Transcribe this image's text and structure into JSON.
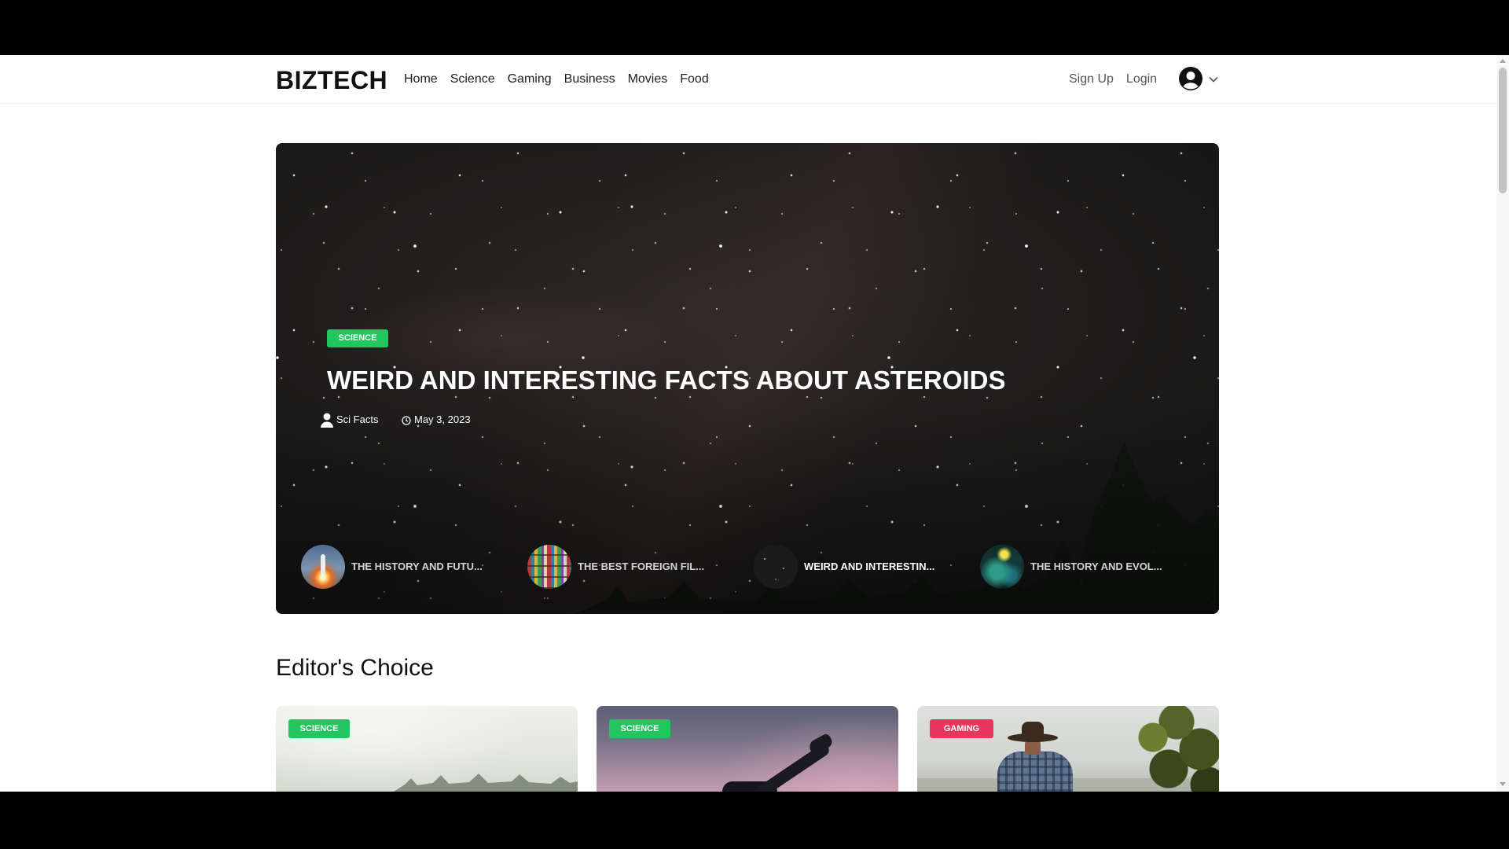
{
  "header": {
    "logo": "BIZTECH",
    "nav": [
      {
        "label": "Home"
      },
      {
        "label": "Science"
      },
      {
        "label": "Gaming"
      },
      {
        "label": "Business"
      },
      {
        "label": "Movies"
      },
      {
        "label": "Food"
      }
    ],
    "auth": {
      "signup": "Sign Up",
      "login": "Login"
    },
    "icons": {
      "avatar": "user-avatar-icon",
      "dropdown": "chevron-down-icon"
    }
  },
  "hero": {
    "category": "SCIENCE",
    "category_color": "#22c55e",
    "title": "WEIRD AND INTERESTING FACTS ABOUT ASTEROIDS",
    "author": "Sci Facts",
    "date": "May 3, 2023",
    "icons": {
      "author": "user-icon",
      "date": "clock-icon"
    },
    "slides": [
      {
        "title": "THE HISTORY AND FUTU...",
        "active": false
      },
      {
        "title": "THE BEST FOREIGN FIL...",
        "active": false
      },
      {
        "title": "WEIRD AND INTERESTIN...",
        "active": true
      },
      {
        "title": "THE HISTORY AND EVOL...",
        "active": false
      }
    ]
  },
  "editors_choice": {
    "heading": "Editor's Choice",
    "cards": [
      {
        "category": "SCIENCE",
        "category_color": "#22c55e"
      },
      {
        "category": "SCIENCE",
        "category_color": "#22c55e"
      },
      {
        "category": "GAMING",
        "category_color": "#e8365d"
      }
    ]
  },
  "colors": {
    "page_background": "#ffffff",
    "text_primary": "#111111",
    "text_muted": "#555555",
    "science": "#22c55e",
    "gaming": "#e8365d"
  }
}
